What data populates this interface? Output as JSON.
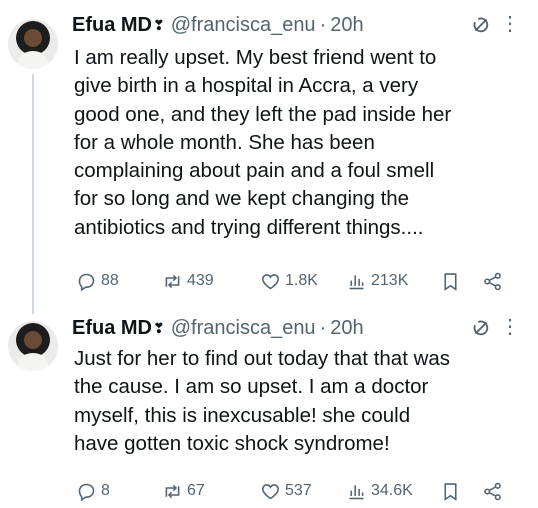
{
  "tweets": [
    {
      "author": {
        "display_name": "Efua MD",
        "badge": "❣",
        "handle": "@francisca_enu",
        "separator": "·",
        "time": "20h"
      },
      "text_lines": [
        "I am really upset. My best friend went to",
        "give birth in a hospital in Accra, a very",
        "good one, and they left the pad inside her",
        "for a whole month. She has been",
        "complaining about pain and a foul smell",
        "for so long and we kept changing the",
        "antibiotics and trying different things...."
      ],
      "stats": {
        "replies": "88",
        "reposts": "439",
        "likes": "1.8K",
        "views": "213K"
      }
    },
    {
      "author": {
        "display_name": "Efua MD",
        "badge": "❣",
        "handle": "@francisca_enu",
        "separator": "·",
        "time": "20h"
      },
      "text_lines": [
        "Just for her to find out today that that was",
        "the cause. I am so upset. I am a doctor",
        "myself, this is inexcusable! she could",
        "have gotten toxic shock syndrome!"
      ],
      "stats": {
        "replies": "8",
        "reposts": "67",
        "likes": "537",
        "views": "34.6K"
      }
    }
  ],
  "icons": {
    "more": "more-options-icon",
    "grok": "grok-icon",
    "reply": "reply-icon",
    "repost": "repost-icon",
    "like": "like-icon",
    "views": "views-icon",
    "bookmark": "bookmark-icon",
    "share": "share-icon"
  },
  "colors": {
    "text": "#0f1419",
    "secondary": "#536471",
    "thread_line": "#cfd9de"
  }
}
